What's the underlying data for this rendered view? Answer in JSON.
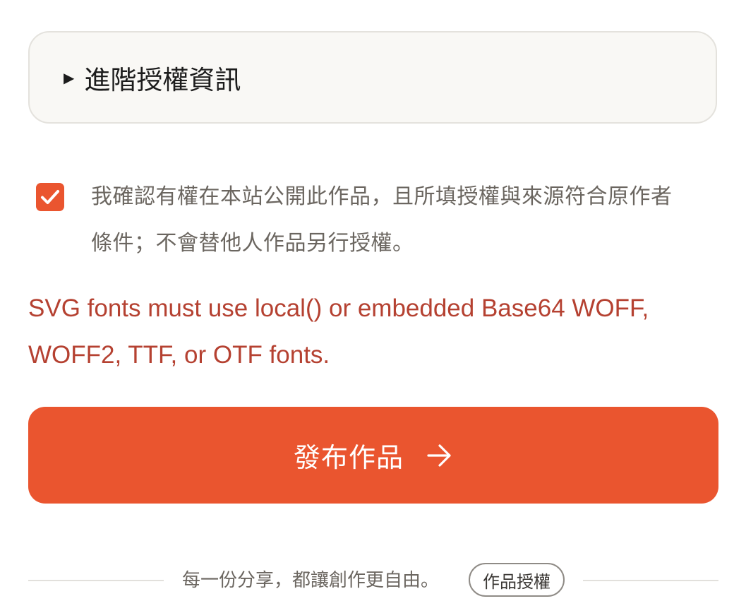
{
  "advanced_license": {
    "caret": "▶",
    "summary": "進階授權資訊"
  },
  "confirm": {
    "checked": true,
    "line1": "我確認有權在本站公開此作品，且所填授權與來源符合原作者",
    "line2": "條件；不會替他人作品另行授權。"
  },
  "error": {
    "line1": "SVG fonts must use local() or embedded Base64 WOFF,",
    "line2": "WOFF2, TTF, or OTF fonts."
  },
  "publish_button": {
    "label": "發布作品",
    "icon": "arrow-right-icon"
  },
  "footer": {
    "tagline": "每一份分享，都讓創作更自由。",
    "license_link": "作品授權"
  },
  "colors": {
    "accent": "#ea552f",
    "error": "#b54131",
    "muted_text": "#6b6660",
    "card_bg": "#f9f8f5"
  }
}
